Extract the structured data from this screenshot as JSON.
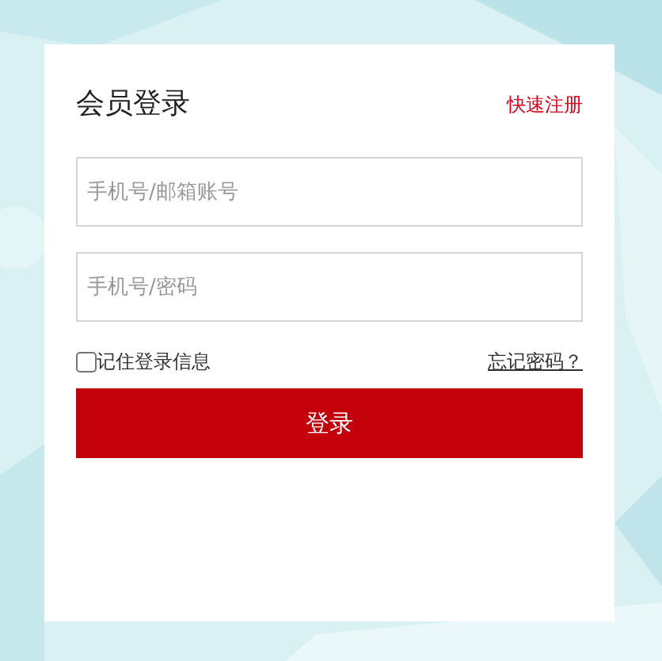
{
  "title": "会员登录",
  "register_link": "快速注册",
  "fields": [
    {
      "placeholder": "手机号/邮箱账号"
    },
    {
      "placeholder": "手机号/密码"
    }
  ],
  "remember": {
    "label": "记住登录信息",
    "checked": false
  },
  "forgot_link": "忘记密码？",
  "submit": "登录"
}
